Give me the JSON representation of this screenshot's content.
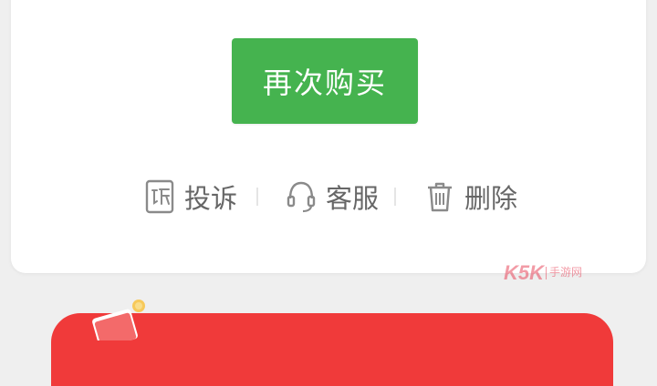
{
  "order_card": {
    "buy_again_label": "再次购买",
    "actions": [
      {
        "icon": "complain-icon",
        "label": "投诉"
      },
      {
        "icon": "headset-icon",
        "label": "客服"
      },
      {
        "icon": "trash-icon",
        "label": "删除"
      }
    ]
  },
  "watermark": {
    "logo_text": "K5K",
    "sub_text": "手游网"
  },
  "colors": {
    "primary_green": "#45b34f",
    "banner_red": "#f03a3a",
    "action_gray": "#666666"
  }
}
